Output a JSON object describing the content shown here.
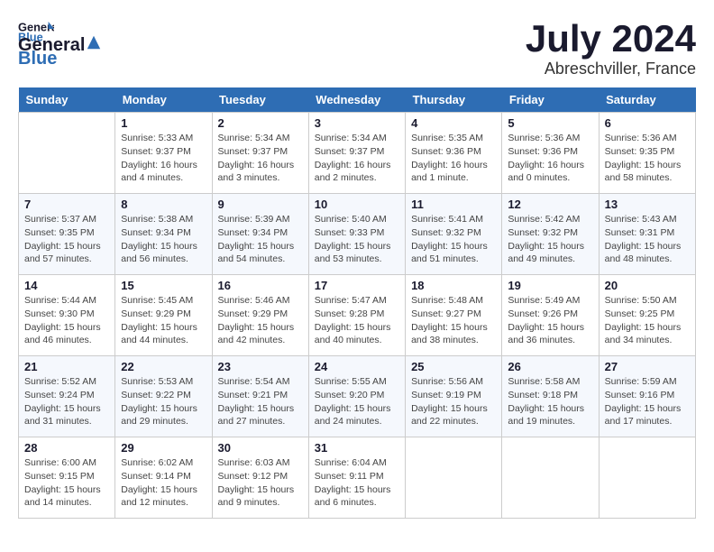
{
  "header": {
    "logo_general": "General",
    "logo_blue": "Blue",
    "month": "July 2024",
    "location": "Abreschviller, France"
  },
  "weekdays": [
    "Sunday",
    "Monday",
    "Tuesday",
    "Wednesday",
    "Thursday",
    "Friday",
    "Saturday"
  ],
  "weeks": [
    {
      "cells": [
        {
          "day": "",
          "info": ""
        },
        {
          "day": "1",
          "info": "Sunrise: 5:33 AM\nSunset: 9:37 PM\nDaylight: 16 hours\nand 4 minutes."
        },
        {
          "day": "2",
          "info": "Sunrise: 5:34 AM\nSunset: 9:37 PM\nDaylight: 16 hours\nand 3 minutes."
        },
        {
          "day": "3",
          "info": "Sunrise: 5:34 AM\nSunset: 9:37 PM\nDaylight: 16 hours\nand 2 minutes."
        },
        {
          "day": "4",
          "info": "Sunrise: 5:35 AM\nSunset: 9:36 PM\nDaylight: 16 hours\nand 1 minute."
        },
        {
          "day": "5",
          "info": "Sunrise: 5:36 AM\nSunset: 9:36 PM\nDaylight: 16 hours\nand 0 minutes."
        },
        {
          "day": "6",
          "info": "Sunrise: 5:36 AM\nSunset: 9:35 PM\nDaylight: 15 hours\nand 58 minutes."
        }
      ]
    },
    {
      "cells": [
        {
          "day": "7",
          "info": "Sunrise: 5:37 AM\nSunset: 9:35 PM\nDaylight: 15 hours\nand 57 minutes."
        },
        {
          "day": "8",
          "info": "Sunrise: 5:38 AM\nSunset: 9:34 PM\nDaylight: 15 hours\nand 56 minutes."
        },
        {
          "day": "9",
          "info": "Sunrise: 5:39 AM\nSunset: 9:34 PM\nDaylight: 15 hours\nand 54 minutes."
        },
        {
          "day": "10",
          "info": "Sunrise: 5:40 AM\nSunset: 9:33 PM\nDaylight: 15 hours\nand 53 minutes."
        },
        {
          "day": "11",
          "info": "Sunrise: 5:41 AM\nSunset: 9:32 PM\nDaylight: 15 hours\nand 51 minutes."
        },
        {
          "day": "12",
          "info": "Sunrise: 5:42 AM\nSunset: 9:32 PM\nDaylight: 15 hours\nand 49 minutes."
        },
        {
          "day": "13",
          "info": "Sunrise: 5:43 AM\nSunset: 9:31 PM\nDaylight: 15 hours\nand 48 minutes."
        }
      ]
    },
    {
      "cells": [
        {
          "day": "14",
          "info": "Sunrise: 5:44 AM\nSunset: 9:30 PM\nDaylight: 15 hours\nand 46 minutes."
        },
        {
          "day": "15",
          "info": "Sunrise: 5:45 AM\nSunset: 9:29 PM\nDaylight: 15 hours\nand 44 minutes."
        },
        {
          "day": "16",
          "info": "Sunrise: 5:46 AM\nSunset: 9:29 PM\nDaylight: 15 hours\nand 42 minutes."
        },
        {
          "day": "17",
          "info": "Sunrise: 5:47 AM\nSunset: 9:28 PM\nDaylight: 15 hours\nand 40 minutes."
        },
        {
          "day": "18",
          "info": "Sunrise: 5:48 AM\nSunset: 9:27 PM\nDaylight: 15 hours\nand 38 minutes."
        },
        {
          "day": "19",
          "info": "Sunrise: 5:49 AM\nSunset: 9:26 PM\nDaylight: 15 hours\nand 36 minutes."
        },
        {
          "day": "20",
          "info": "Sunrise: 5:50 AM\nSunset: 9:25 PM\nDaylight: 15 hours\nand 34 minutes."
        }
      ]
    },
    {
      "cells": [
        {
          "day": "21",
          "info": "Sunrise: 5:52 AM\nSunset: 9:24 PM\nDaylight: 15 hours\nand 31 minutes."
        },
        {
          "day": "22",
          "info": "Sunrise: 5:53 AM\nSunset: 9:22 PM\nDaylight: 15 hours\nand 29 minutes."
        },
        {
          "day": "23",
          "info": "Sunrise: 5:54 AM\nSunset: 9:21 PM\nDaylight: 15 hours\nand 27 minutes."
        },
        {
          "day": "24",
          "info": "Sunrise: 5:55 AM\nSunset: 9:20 PM\nDaylight: 15 hours\nand 24 minutes."
        },
        {
          "day": "25",
          "info": "Sunrise: 5:56 AM\nSunset: 9:19 PM\nDaylight: 15 hours\nand 22 minutes."
        },
        {
          "day": "26",
          "info": "Sunrise: 5:58 AM\nSunset: 9:18 PM\nDaylight: 15 hours\nand 19 minutes."
        },
        {
          "day": "27",
          "info": "Sunrise: 5:59 AM\nSunset: 9:16 PM\nDaylight: 15 hours\nand 17 minutes."
        }
      ]
    },
    {
      "cells": [
        {
          "day": "28",
          "info": "Sunrise: 6:00 AM\nSunset: 9:15 PM\nDaylight: 15 hours\nand 14 minutes."
        },
        {
          "day": "29",
          "info": "Sunrise: 6:02 AM\nSunset: 9:14 PM\nDaylight: 15 hours\nand 12 minutes."
        },
        {
          "day": "30",
          "info": "Sunrise: 6:03 AM\nSunset: 9:12 PM\nDaylight: 15 hours\nand 9 minutes."
        },
        {
          "day": "31",
          "info": "Sunrise: 6:04 AM\nSunset: 9:11 PM\nDaylight: 15 hours\nand 6 minutes."
        },
        {
          "day": "",
          "info": ""
        },
        {
          "day": "",
          "info": ""
        },
        {
          "day": "",
          "info": ""
        }
      ]
    }
  ]
}
